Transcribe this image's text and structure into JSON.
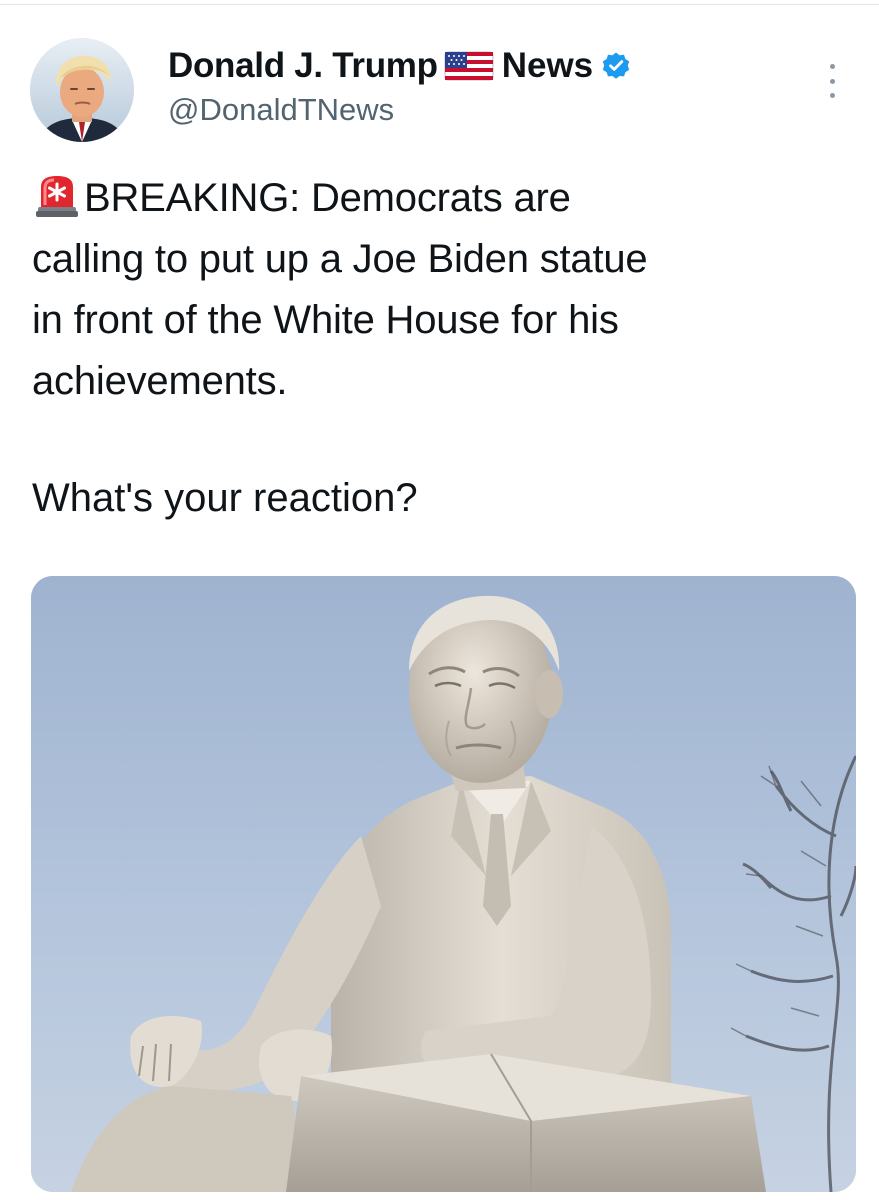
{
  "author": {
    "display_name": "Donald J. Trump",
    "flag_icon": "us-flag-icon",
    "name_suffix": "News",
    "verified_icon": "verified-badge-icon",
    "verified_color": "#1d9bf0",
    "handle": "@DonaldTNews"
  },
  "tweet": {
    "emoji_icon": "rotating-light-icon",
    "text_line_1": "BREAKING: Democrats are",
    "text_line_2": "calling to put up a Joe Biden statue",
    "text_line_3": "in front of the White House for his",
    "text_line_4": "achievements.",
    "question": "What's your reaction?"
  },
  "media": {
    "icon": "statue-photo",
    "sky_color": "#a9bcd6"
  },
  "colors": {
    "text_primary": "#0f1419",
    "text_secondary": "#536471"
  }
}
